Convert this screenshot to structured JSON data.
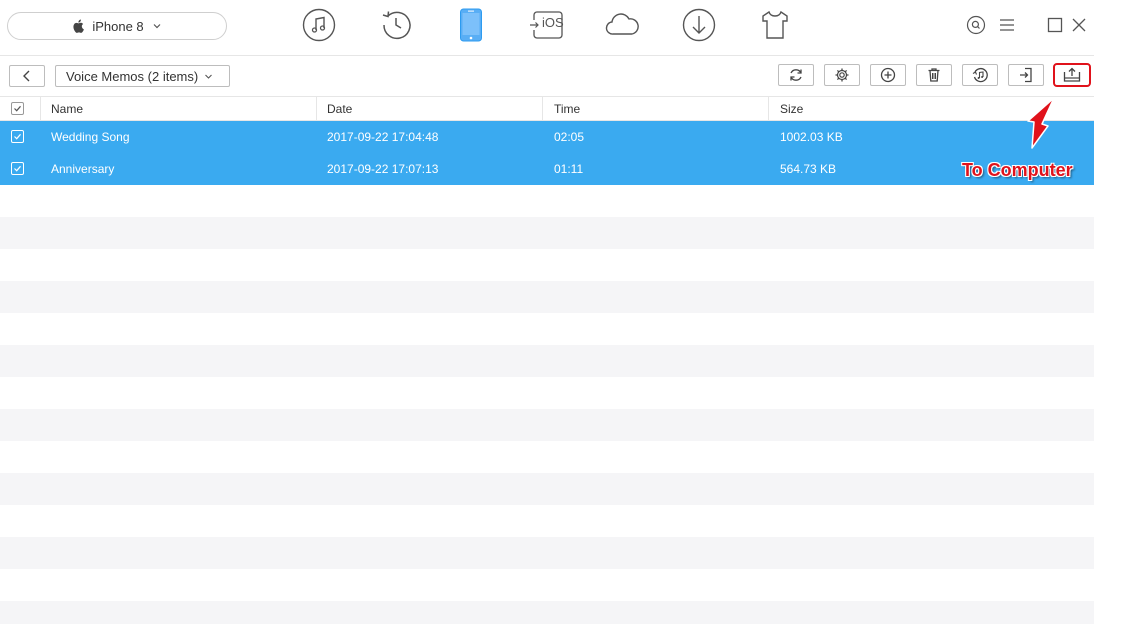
{
  "device": {
    "name": "iPhone 8"
  },
  "nav_icons": [
    "music-icon",
    "history-icon",
    "phone-icon",
    "to-ios-icon",
    "cloud-icon",
    "download-icon",
    "tshirt-icon"
  ],
  "nav_to_ios_label": "iOS",
  "window_controls": [
    "search-icon",
    "menu-icon",
    "maximize-icon",
    "close-icon"
  ],
  "category": {
    "label": "Voice Memos (2 items)"
  },
  "toolbar_icons": [
    "refresh-icon",
    "settings-icon",
    "add-icon",
    "delete-icon",
    "to-itunes-icon",
    "to-device-icon",
    "to-computer-icon"
  ],
  "columns": {
    "name": "Name",
    "date": "Date",
    "time": "Time",
    "size": "Size"
  },
  "rows": [
    {
      "name": "Wedding Song",
      "date": "2017-09-22 17:04:48",
      "time": "02:05",
      "size": "1002.03 KB",
      "checked": true
    },
    {
      "name": "Anniversary",
      "date": "2017-09-22 17:07:13",
      "time": "01:11",
      "size": "564.73 KB",
      "checked": true
    }
  ],
  "annotation": {
    "text": "To Computer"
  },
  "colors": {
    "selected_row": "#3aaaf0",
    "active_nav": "#2d9bf0",
    "annotation": "#e0121b",
    "alt_row": "#f5f5f7"
  }
}
